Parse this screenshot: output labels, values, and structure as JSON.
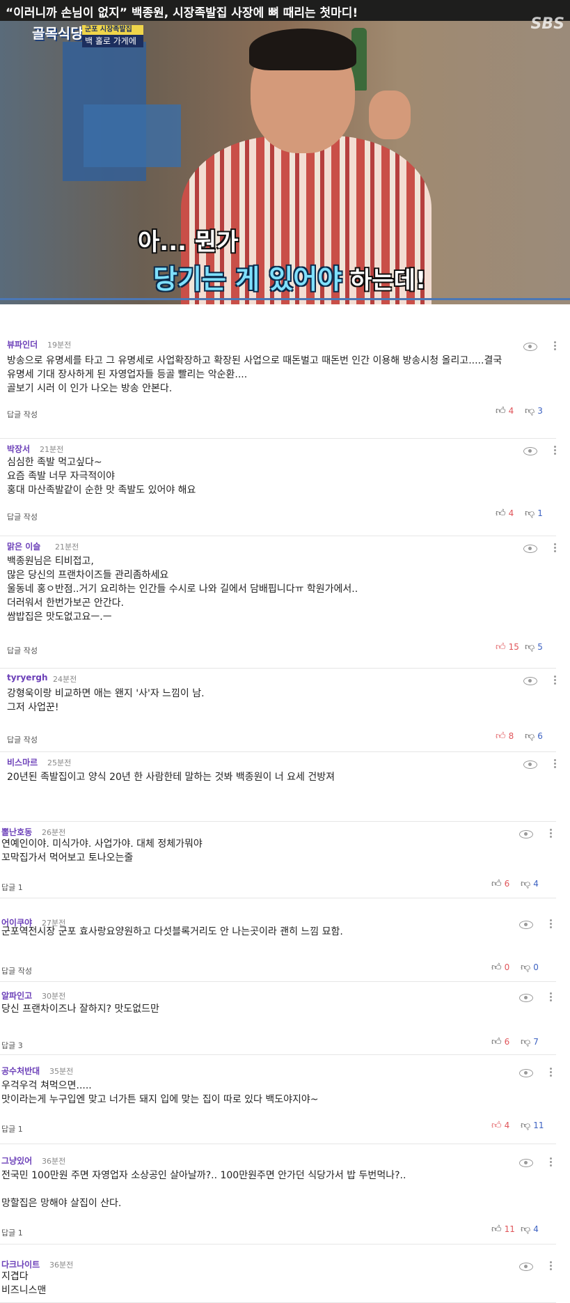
{
  "video": {
    "title_quote": "“이러니까 손님이 없지”",
    "title_rest": " 백종원, 시장족발집 사장에 뼈 때리는 첫마디!",
    "channel_logo": "SBS",
    "show_logo": "골목식당",
    "badge": "군포 시장족발집",
    "tag": "백 홀로 가게에",
    "caption_line1": "아... 뭔가",
    "caption_line2_a": "당기는 게 있어야",
    "caption_line2_b": " 하는데!"
  },
  "comments": [
    {
      "author": "뷰파인더",
      "time": "19분전",
      "lines": [
        "방송으로 유명세를 타고 그 유명세로 사업확장하고 확장된 사업으로 때돈벌고 때돈번 인간 이용해 방송시청 올리고.....결국",
        "유명세 기대 장사하게 된 자영업자들 등골 빨리는 악순환....",
        "골보기 시러 이 인가 나오는 방송 안본다."
      ],
      "reply": "답글 작성",
      "likes": "4",
      "dislikes": "3",
      "hot": false
    },
    {
      "author": "박장서",
      "time": "21분전",
      "lines": [
        "심심한 족발 먹고싶다~",
        "요즘 족발 너무 자극적이야",
        "홍대 마산족발같이 순한 맛 족발도 있어야 해요"
      ],
      "reply": "답글 작성",
      "likes": "4",
      "dislikes": "1",
      "hot": false
    },
    {
      "author": "맑은 이슬",
      "time": "21분전",
      "lines": [
        "백종원님은 티비접고,",
        "많은  당신의 프랜차이즈들 관리좀하세요",
        "울동네 홍ㅇ반점..거기 요리하는 인간들 수시로 나와 길에서 담배핍니다ㅠ 학원가에서..",
        "더러워서 한번가보곤 안간다.",
        "쌈밥집은 맛도없고요ㅡ.ㅡ"
      ],
      "reply": "답글 작성",
      "likes": "15",
      "dislikes": "5",
      "hot": true
    },
    {
      "author": "tyryergh",
      "time": "24분전",
      "lines": [
        "강형욱이랑 비교하면 애는 왠지 '사'자 느낌이 남.",
        "그저 사업꾼!"
      ],
      "reply": "답글 작성",
      "likes": "8",
      "dislikes": "6",
      "hot": true
    },
    {
      "author": "비스마르",
      "time": "25분전",
      "lines": [
        "20년된 족발집이고 양식 20년 한 사람한테 말하는 것봐  백종원이 너 요세 건방져"
      ],
      "reply": "",
      "likes": "",
      "dislikes": "",
      "hot": false
    },
    {
      "author": "뽈난호동",
      "time": "26분전",
      "lines": [
        "연예인이야. 미식가야. 사업가야. 대체 정체가뭐야",
        "꼬막집가서 먹어보고 토나오는줄"
      ],
      "reply": "답글 1",
      "likes": "6",
      "dislikes": "4",
      "hot": false
    },
    {
      "author": "어이쿠야",
      "time": "27분전",
      "lines": [
        "군포역전시장 군포 효사랑요양원하고 다섯블록거리도 안 나는곳이라 괜히 느낌 묘함."
      ],
      "reply": "답글 작성",
      "likes": "0",
      "dislikes": "0",
      "hot": false
    },
    {
      "author": "알파인고",
      "time": "30분전",
      "lines": [
        "당신 프랜차이즈나 잘하지?  맛도없드만"
      ],
      "reply": "답글 3",
      "likes": "6",
      "dislikes": "7",
      "hot": false
    },
    {
      "author": "공수처반대",
      "time": "35분전",
      "lines": [
        "우걱우걱 쳐먹으면.....",
        "맛이라는게 누구입엔 맞고 너가튼 돼지 입에 맞는 집이 따로 있다 백도야지야~"
      ],
      "reply": "답글 1",
      "likes": "4",
      "dislikes": "11",
      "hot": true
    },
    {
      "author": "그냥있어",
      "time": "36분전",
      "lines": [
        "전국민 100만원 주면 자영업자 소상공인  살아날까?.. 100만원주면 안가던 식당가서 밥 두번먹나?..",
        "",
        "망할집은 망해야 살집이 산다."
      ],
      "reply": "답글 1",
      "likes": "11",
      "dislikes": "4",
      "hot": false
    },
    {
      "author": "다크나이트",
      "time": "36분전",
      "lines": [
        "지겹다",
        "비즈니스맨"
      ],
      "reply": "",
      "likes": "",
      "dislikes": "",
      "hot": false
    }
  ]
}
